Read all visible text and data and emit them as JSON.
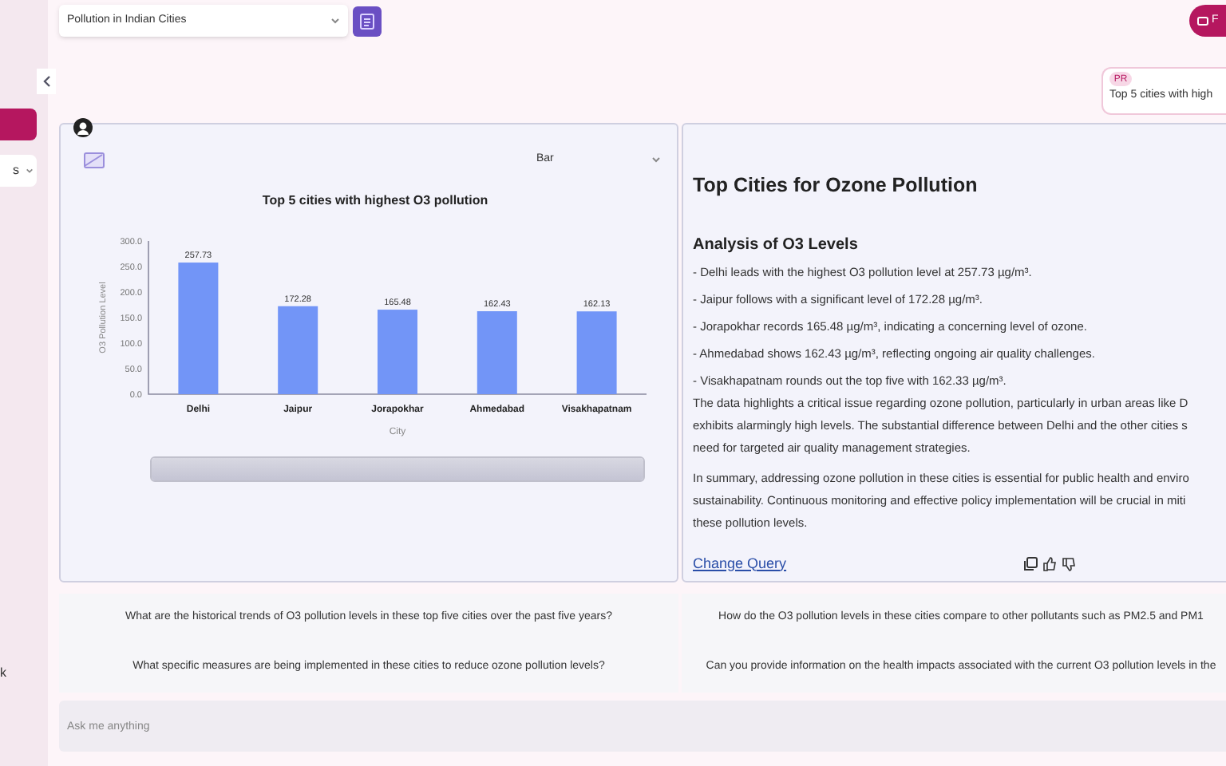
{
  "sidebar": {
    "items": [
      {
        "kind": "button"
      },
      {
        "kind": "select",
        "label": "s"
      },
      {
        "kind": "text",
        "label": "k"
      }
    ]
  },
  "header": {
    "dataset_select": {
      "value": "Pollution in Indian Cities"
    },
    "top_button": {
      "label": "F"
    }
  },
  "user_message": {
    "avatar": "PR",
    "text": "Top 5 cities with high"
  },
  "chart_card": {
    "chart_type_select": {
      "value": "Bar"
    },
    "range_slider": {
      "level": 1
    },
    "chart_data": {
      "type": "bar",
      "title": "Top 5 cities with highest O3 pollution",
      "xlabel": "City",
      "ylabel": "O3 Pollution Level",
      "categories": [
        "Delhi",
        "Jaipur",
        "Jorapokhar",
        "Ahmedabad",
        "Visakhapatnam"
      ],
      "series": [
        {
          "color": "#7295f7",
          "values": [
            257.73,
            172.28,
            165.48,
            162.43,
            162.13
          ]
        }
      ],
      "ylim": [
        0,
        300
      ],
      "yticks": [
        {
          "value": 0,
          "label": "0.0"
        },
        {
          "value": 50,
          "label": "50.0"
        },
        {
          "value": 100,
          "label": "100.0"
        },
        {
          "value": 150,
          "label": "150.0"
        },
        {
          "value": 200,
          "label": "200.0"
        },
        {
          "value": 250,
          "label": "250.0"
        },
        {
          "value": 300,
          "label": "300.0"
        }
      ],
      "data_labels": true
    }
  },
  "answer_card": {
    "title": "Top Cities for Ozone Pollution",
    "heading": "Analysis of O3 Levels",
    "bullets": [
      "- Delhi leads with the highest O3 pollution level at 257.73 µg/m³.",
      "- Jaipur follows with a significant level of 172.28 µg/m³.",
      "- Jorapokhar records 165.48 µg/m³, indicating a concerning level of ozone.",
      "- Ahmedabad shows 162.43 µg/m³, reflecting ongoing air quality challenges.",
      "- Visakhapatnam rounds out the top five with 162.33 µg/m³."
    ],
    "paragraphs": [
      {
        "lines": [
          "The data highlights a critical issue regarding ozone pollution, particularly in urban areas like D",
          "exhibits alarmingly high levels. The substantial difference between Delhi and the other cities s",
          "need for targeted air quality management strategies."
        ]
      },
      {
        "lines": [
          "In summary, addressing ozone pollution in these cities is essential for public health and enviro",
          "sustainability. Continuous monitoring and effective policy implementation will be crucial in miti",
          "these pollution levels."
        ]
      }
    ],
    "link": "Change Query"
  },
  "suggestions": [
    "What are the historical trends of O3 pollution levels in these top five cities over the past five years?",
    "How do the O3 pollution levels in these cities compare to other pollutants such as PM2.5 and PM1",
    "What specific measures are being implemented in these cities to reduce ozone pollution levels?",
    "Can you provide information on the health impacts associated with the current O3 pollution levels in the"
  ],
  "input": {
    "placeholder": "Ask me anything"
  }
}
